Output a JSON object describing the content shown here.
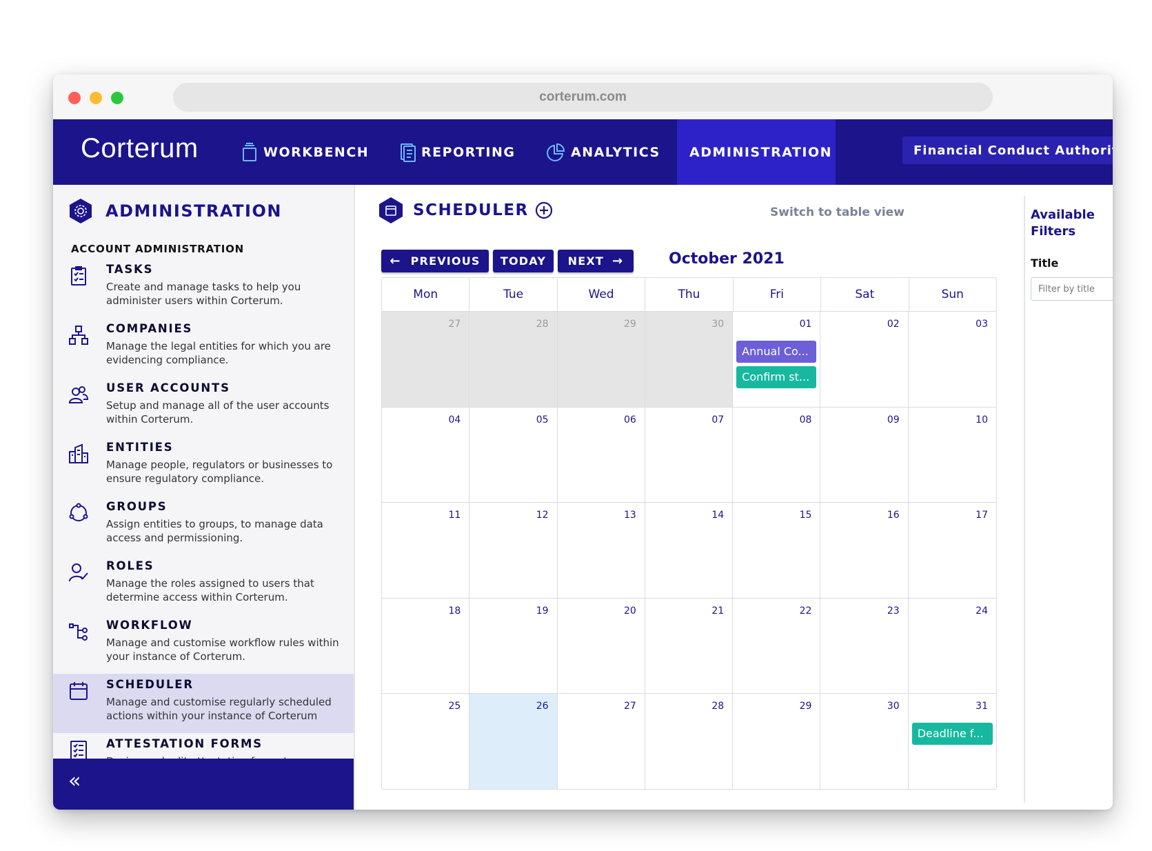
{
  "browser": {
    "url": "corterum.com"
  },
  "brand": "Corterum",
  "nav": {
    "workbench": "WORKBENCH",
    "reporting": "REPORTING",
    "analytics": "ANALYTICS",
    "administration": "ADMINISTRATION",
    "org": "Financial Conduct Authority"
  },
  "sidebar": {
    "title": "ADMINISTRATION",
    "section": "ACCOUNT ADMINISTRATION",
    "items": [
      {
        "name": "TASKS",
        "desc": "Create and manage tasks to help you administer users within Corterum."
      },
      {
        "name": "COMPANIES",
        "desc": "Manage the legal entities for which you are evidencing compliance."
      },
      {
        "name": "USER ACCOUNTS",
        "desc": "Setup and manage all of the user accounts within Corterum."
      },
      {
        "name": "ENTITIES",
        "desc": "Manage people, regulators or businesses to ensure regulatory compliance."
      },
      {
        "name": "GROUPS",
        "desc": "Assign entities to groups, to manage data access and permissioning."
      },
      {
        "name": "ROLES",
        "desc": "Manage the roles assigned to users that determine access within Corterum."
      },
      {
        "name": "WORKFLOW",
        "desc": "Manage and customise workflow rules within your instance of Corterum."
      },
      {
        "name": "SCHEDULER",
        "desc": "Manage and customise regularly scheduled actions within your instance of Corterum"
      },
      {
        "name": "ATTESTATION FORMS",
        "desc": "Design and edit attestation forms to"
      }
    ],
    "collapse": "«"
  },
  "main": {
    "title": "SCHEDULER",
    "switch_link": "Switch to table view",
    "prev": "PREVIOUS",
    "today": "TODAY",
    "next": "NEXT",
    "month": "October 2021"
  },
  "calendar": {
    "weekdays": [
      "Mon",
      "Tue",
      "Wed",
      "Thu",
      "Fri",
      "Sat",
      "Sun"
    ],
    "days": [
      "27",
      "28",
      "29",
      "30",
      "01",
      "02",
      "03",
      "04",
      "05",
      "06",
      "07",
      "08",
      "09",
      "10",
      "11",
      "12",
      "13",
      "14",
      "15",
      "16",
      "17",
      "18",
      "19",
      "20",
      "21",
      "22",
      "23",
      "24",
      "25",
      "26",
      "27",
      "28",
      "29",
      "30",
      "31"
    ],
    "events": [
      {
        "cell": 4,
        "slot": 0,
        "label": "Annual Co...",
        "color": "#6c5fd8"
      },
      {
        "cell": 4,
        "slot": 1,
        "label": "Confirm st...",
        "color": "#16b8a0"
      },
      {
        "cell": 34,
        "slot": 0,
        "label": "Deadline f...",
        "color": "#16b8a0"
      }
    ]
  },
  "filters": {
    "title": "Available Filters",
    "title_label": "Title",
    "title_placeholder": "Filter by title"
  }
}
